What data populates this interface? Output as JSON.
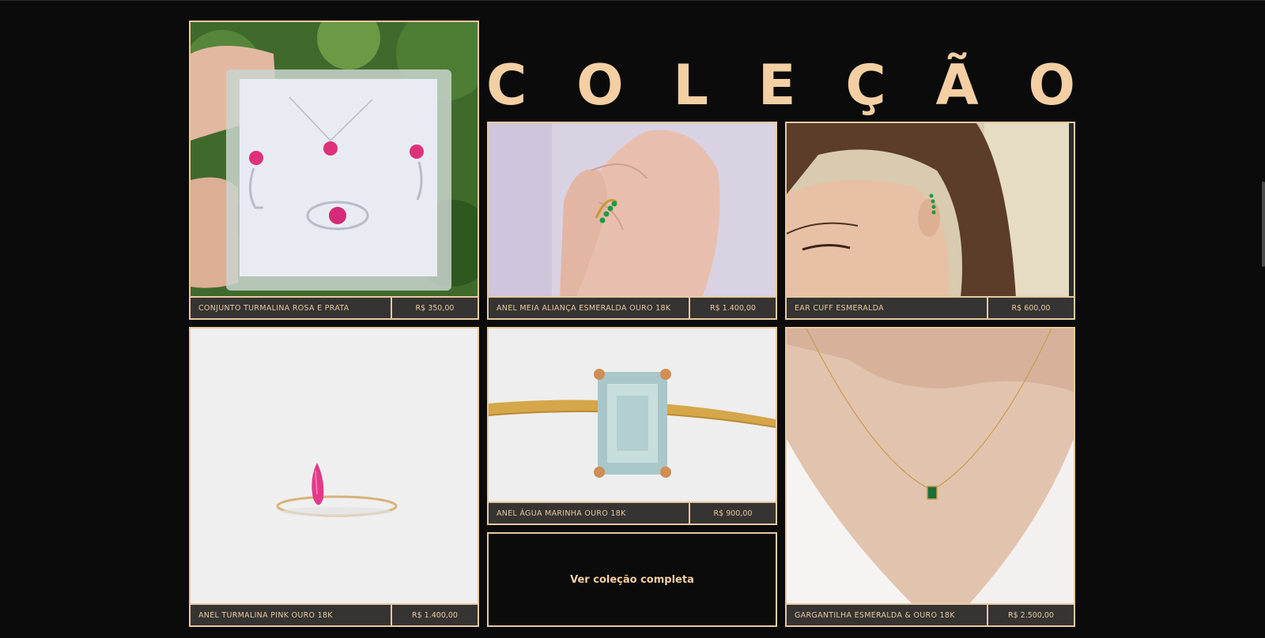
{
  "heading": {
    "letters": [
      "C",
      "O",
      "L",
      "E",
      "Ç",
      "Ã",
      "O"
    ]
  },
  "products": [
    {
      "name": "CONJUNTO TURMALINA ROSA E PRATA",
      "price": "R$ 350,00"
    },
    {
      "name": "ANEL MEIA ALIANÇA ESMERALDA OURO 18K",
      "price": "R$ 1.400,00"
    },
    {
      "name": "EAR CUFF ESMERALDA",
      "price": "R$ 600,00"
    },
    {
      "name": "ANEL TURMALINA PINK OURO 18K",
      "price": "R$ 1.400,00"
    },
    {
      "name": "ANEL ÁGUA MARINHA OURO 18K",
      "price": "R$ 900,00"
    },
    {
      "name": "GARGANTILHA ESMERALDA & OURO 18K",
      "price": "R$ 2.500,00"
    }
  ],
  "view_all_label": "Ver coleção completa",
  "colors": {
    "accent": "#e8c9a0",
    "title": "#f3cfa3",
    "background": "#0b0b0b",
    "caption_bg": "#3a3836"
  }
}
